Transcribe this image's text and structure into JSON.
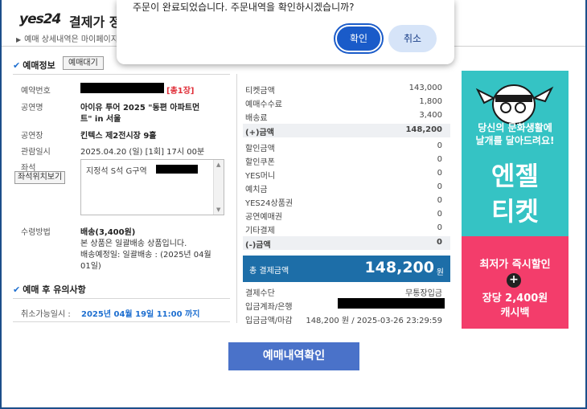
{
  "header": {
    "logo": "yes24",
    "title": "결제가 정",
    "breadcrumb": "예매 상세내역은 마이페이지"
  },
  "dialog": {
    "message": "주문이 완료되었습니다. 주문내역을 확인하시겠습니까?",
    "ok_label": "확인",
    "cancel_label": "취소"
  },
  "ticket_info": {
    "section_title": "예매정보",
    "wait_button": "예매대기",
    "booking_no_label": "예약번호",
    "ticket_count": "[총1장]",
    "performance_label": "공연명",
    "performance_line1": "아이유 투어 2025 \"동편 아파트먼",
    "performance_line2": "트\" in 서울",
    "venue_label": "공연장",
    "venue": "킨텍스 제2전시장 9홀",
    "datetime_label": "관람일시",
    "datetime": "2025.04.20 (일) [1회] 17시 00분",
    "seat_label": "좌석",
    "seat_position_button": "좌석위치보기",
    "seat_text": "지정석 S석 G구역",
    "receipt_label": "수령방법",
    "receipt_method": "배송(3,400원)",
    "receipt_note1": "본 상품은 일괄배송 상품입니다.",
    "receipt_note2": "배송예정일: 일괄배송 : (2025년 04월",
    "receipt_note3": "01일)"
  },
  "cautions": {
    "section_title": "예매 후 유의사항",
    "cancel_label": "취소가능일시 :",
    "cancel_deadline": "2025년 04월 19일 11:00 까지"
  },
  "payment": {
    "rows_plus": [
      {
        "label": "티켓금액",
        "value": "143,000"
      },
      {
        "label": "예매수수료",
        "value": "1,800"
      },
      {
        "label": "배송료",
        "value": "3,400"
      }
    ],
    "plus_sum_label": "(+)금액",
    "plus_sum_value": "148,200",
    "rows_minus": [
      {
        "label": "할인금액",
        "value": "0"
      },
      {
        "label": "할인쿠폰",
        "value": "0"
      },
      {
        "label": "YES머니",
        "value": "0"
      },
      {
        "label": "예치금",
        "value": "0"
      },
      {
        "label": "YES24상품권",
        "value": "0"
      },
      {
        "label": "공연예매권",
        "value": "0"
      },
      {
        "label": "기타결제",
        "value": "0"
      }
    ],
    "minus_sum_label": "(-)금액",
    "minus_sum_value": "0",
    "total_label": "총 결제금액",
    "total_value": "148,200",
    "total_unit": "원",
    "method_label": "결제수단",
    "method_value": "무통장입금",
    "account_label": "입금계좌/은행",
    "deadline_label": "입금금액/마감",
    "deadline_value": "148,200 원 / 2025-03-26 23:29:59"
  },
  "banner": {
    "line1": "당신의 문화생활에",
    "line2": "날개를 달아드려요!",
    "big1": "엔젤",
    "big2": "티켓",
    "line3": "최저가 즉시할인",
    "line4": "장당 2,400원",
    "line5": "캐시백"
  },
  "bottom_button": "예매내역확인"
}
